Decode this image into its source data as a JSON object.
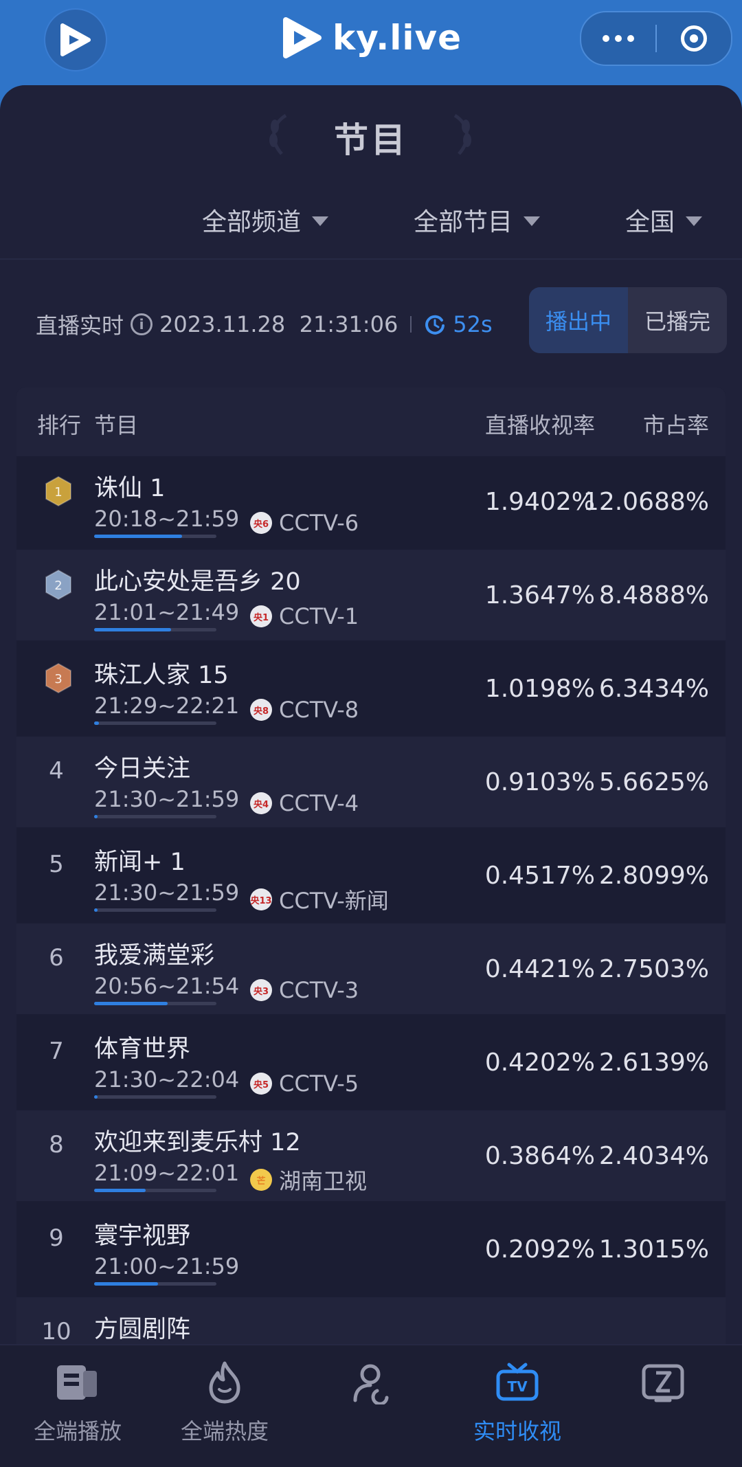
{
  "header": {
    "brand": "ky.live"
  },
  "page": {
    "title": "节目"
  },
  "filters": [
    {
      "label": "全部频道"
    },
    {
      "label": "全部节目"
    },
    {
      "label": "全国"
    }
  ],
  "status": {
    "label": "直播实时",
    "timestamp": "2023.11.28  21:31:06",
    "refresh": "52s"
  },
  "toggle": {
    "on_air": "播出中",
    "finished": "已播完"
  },
  "table": {
    "headers": {
      "rank": "排行",
      "program": "节目",
      "rating": "直播收视率",
      "share": "市占率"
    },
    "rows": [
      {
        "rank": "1",
        "name": "诛仙 1",
        "time": "20:18~21:59",
        "channel": "CCTV-6",
        "ch_badge": "央6",
        "rating": "1.9402%",
        "share": "12.0688%",
        "progress": 0.72,
        "medal": "gold"
      },
      {
        "rank": "2",
        "name": "此心安处是吾乡 20",
        "time": "21:01~21:49",
        "channel": "CCTV-1",
        "ch_badge": "央1",
        "rating": "1.3647%",
        "share": "8.4888%",
        "progress": 0.63,
        "medal": "silver"
      },
      {
        "rank": "3",
        "name": "珠江人家 15",
        "time": "21:29~22:21",
        "channel": "CCTV-8",
        "ch_badge": "央8",
        "rating": "1.0198%",
        "share": "6.3434%",
        "progress": 0.04,
        "medal": "bronze"
      },
      {
        "rank": "4",
        "name": "今日关注",
        "time": "21:30~21:59",
        "channel": "CCTV-4",
        "ch_badge": "央4",
        "rating": "0.9103%",
        "share": "5.6625%",
        "progress": 0.03
      },
      {
        "rank": "5",
        "name": "新闻+ 1",
        "time": "21:30~21:59",
        "channel": "CCTV-新闻",
        "ch_badge": "央13",
        "rating": "0.4517%",
        "share": "2.8099%",
        "progress": 0.03
      },
      {
        "rank": "6",
        "name": "我爱满堂彩",
        "time": "20:56~21:54",
        "channel": "CCTV-3",
        "ch_badge": "央3",
        "rating": "0.4421%",
        "share": "2.7503%",
        "progress": 0.6
      },
      {
        "rank": "7",
        "name": "体育世界",
        "time": "21:30~22:04",
        "channel": "CCTV-5",
        "ch_badge": "央5",
        "rating": "0.4202%",
        "share": "2.6139%",
        "progress": 0.03
      },
      {
        "rank": "8",
        "name": "欢迎来到麦乐村 12",
        "time": "21:09~22:01",
        "channel": "湖南卫视",
        "ch_badge": "芒",
        "rating": "0.3864%",
        "share": "2.4034%",
        "progress": 0.42,
        "hunan": true
      },
      {
        "rank": "9",
        "name": "寰宇视野",
        "time": "21:00~21:59",
        "channel": "",
        "ch_badge": "",
        "rating": "0.2092%",
        "share": "1.3015%",
        "progress": 0.52
      },
      {
        "rank": "10",
        "name": "方圆剧阵",
        "time": "",
        "channel": "",
        "ch_badge": "",
        "rating": "",
        "share": "",
        "progress": 0
      }
    ]
  },
  "tabbar": [
    {
      "label": "全端播放",
      "icon": "play-card-icon",
      "active": false
    },
    {
      "label": "全端热度",
      "icon": "flame-icon",
      "active": false
    },
    {
      "label": "",
      "icon": "user-refresh-icon",
      "active": false
    },
    {
      "label": "实时收视",
      "icon": "tv-icon",
      "active": true
    },
    {
      "label": "",
      "icon": "hourglass-icon",
      "active": false
    }
  ],
  "colors": {
    "accent": "#2f8df5",
    "header_bg": "#2f74c8",
    "page_bg": "#1d1f35",
    "gold": "#c9a13c",
    "silver": "#8aa2c4",
    "bronze": "#c77a52"
  }
}
